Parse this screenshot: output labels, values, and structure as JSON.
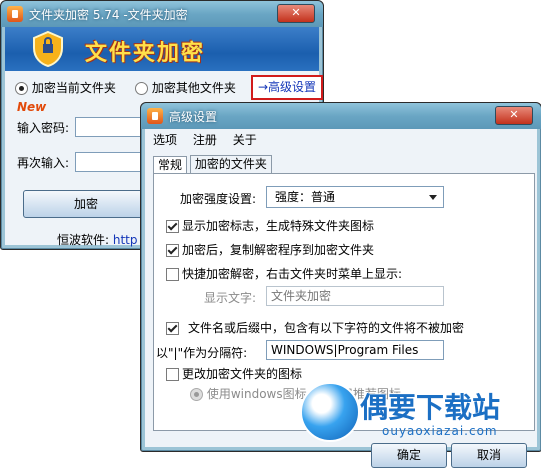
{
  "main_window": {
    "title": "文件夹加密 5.74 -文件夹加密",
    "banner_title": "文件夹加密",
    "radio_current": "加密当前文件夹",
    "radio_other": "加密其他文件夹",
    "advanced_link": "→高级设置",
    "new_tag": "New",
    "password_label": "输入密码:",
    "confirm_label": "再次输入:",
    "encrypt_button": "加密",
    "footer_text": "恒波软件:",
    "footer_link": "http"
  },
  "advanced_dialog": {
    "title": "高级设置",
    "menu": [
      "选项",
      "注册",
      "关于"
    ],
    "tabs": [
      "常规",
      "加密的文件夹"
    ],
    "strength_label": "加密强度设置:",
    "strength_value": "强度：普通",
    "show_marker": "显示加密标志，生成特殊文件夹图标",
    "copy_decryptor": "加密后，复制解密程序到加密文件夹",
    "quick_decrypt": "快捷加密解密，右击文件夹时菜单上显示:",
    "display_text_label": "显示文字:",
    "display_text_value": "文件夹加密",
    "exclude_chars": "文件名或后缀中，包含有以下字符的文件将不被加密",
    "separator_label": "以\"|\"作为分隔符:",
    "separator_value": "WINDOWS|Program Files",
    "change_icon": "更改加密文件夹的图标",
    "use_windows_icon": "使用windows图标",
    "use_recommended_icon": "使用推荐图标",
    "ok_button": "确定",
    "cancel_button": "取消"
  },
  "watermark": {
    "title": "偶要下载站",
    "url": "ouyaoxiazai.com"
  }
}
